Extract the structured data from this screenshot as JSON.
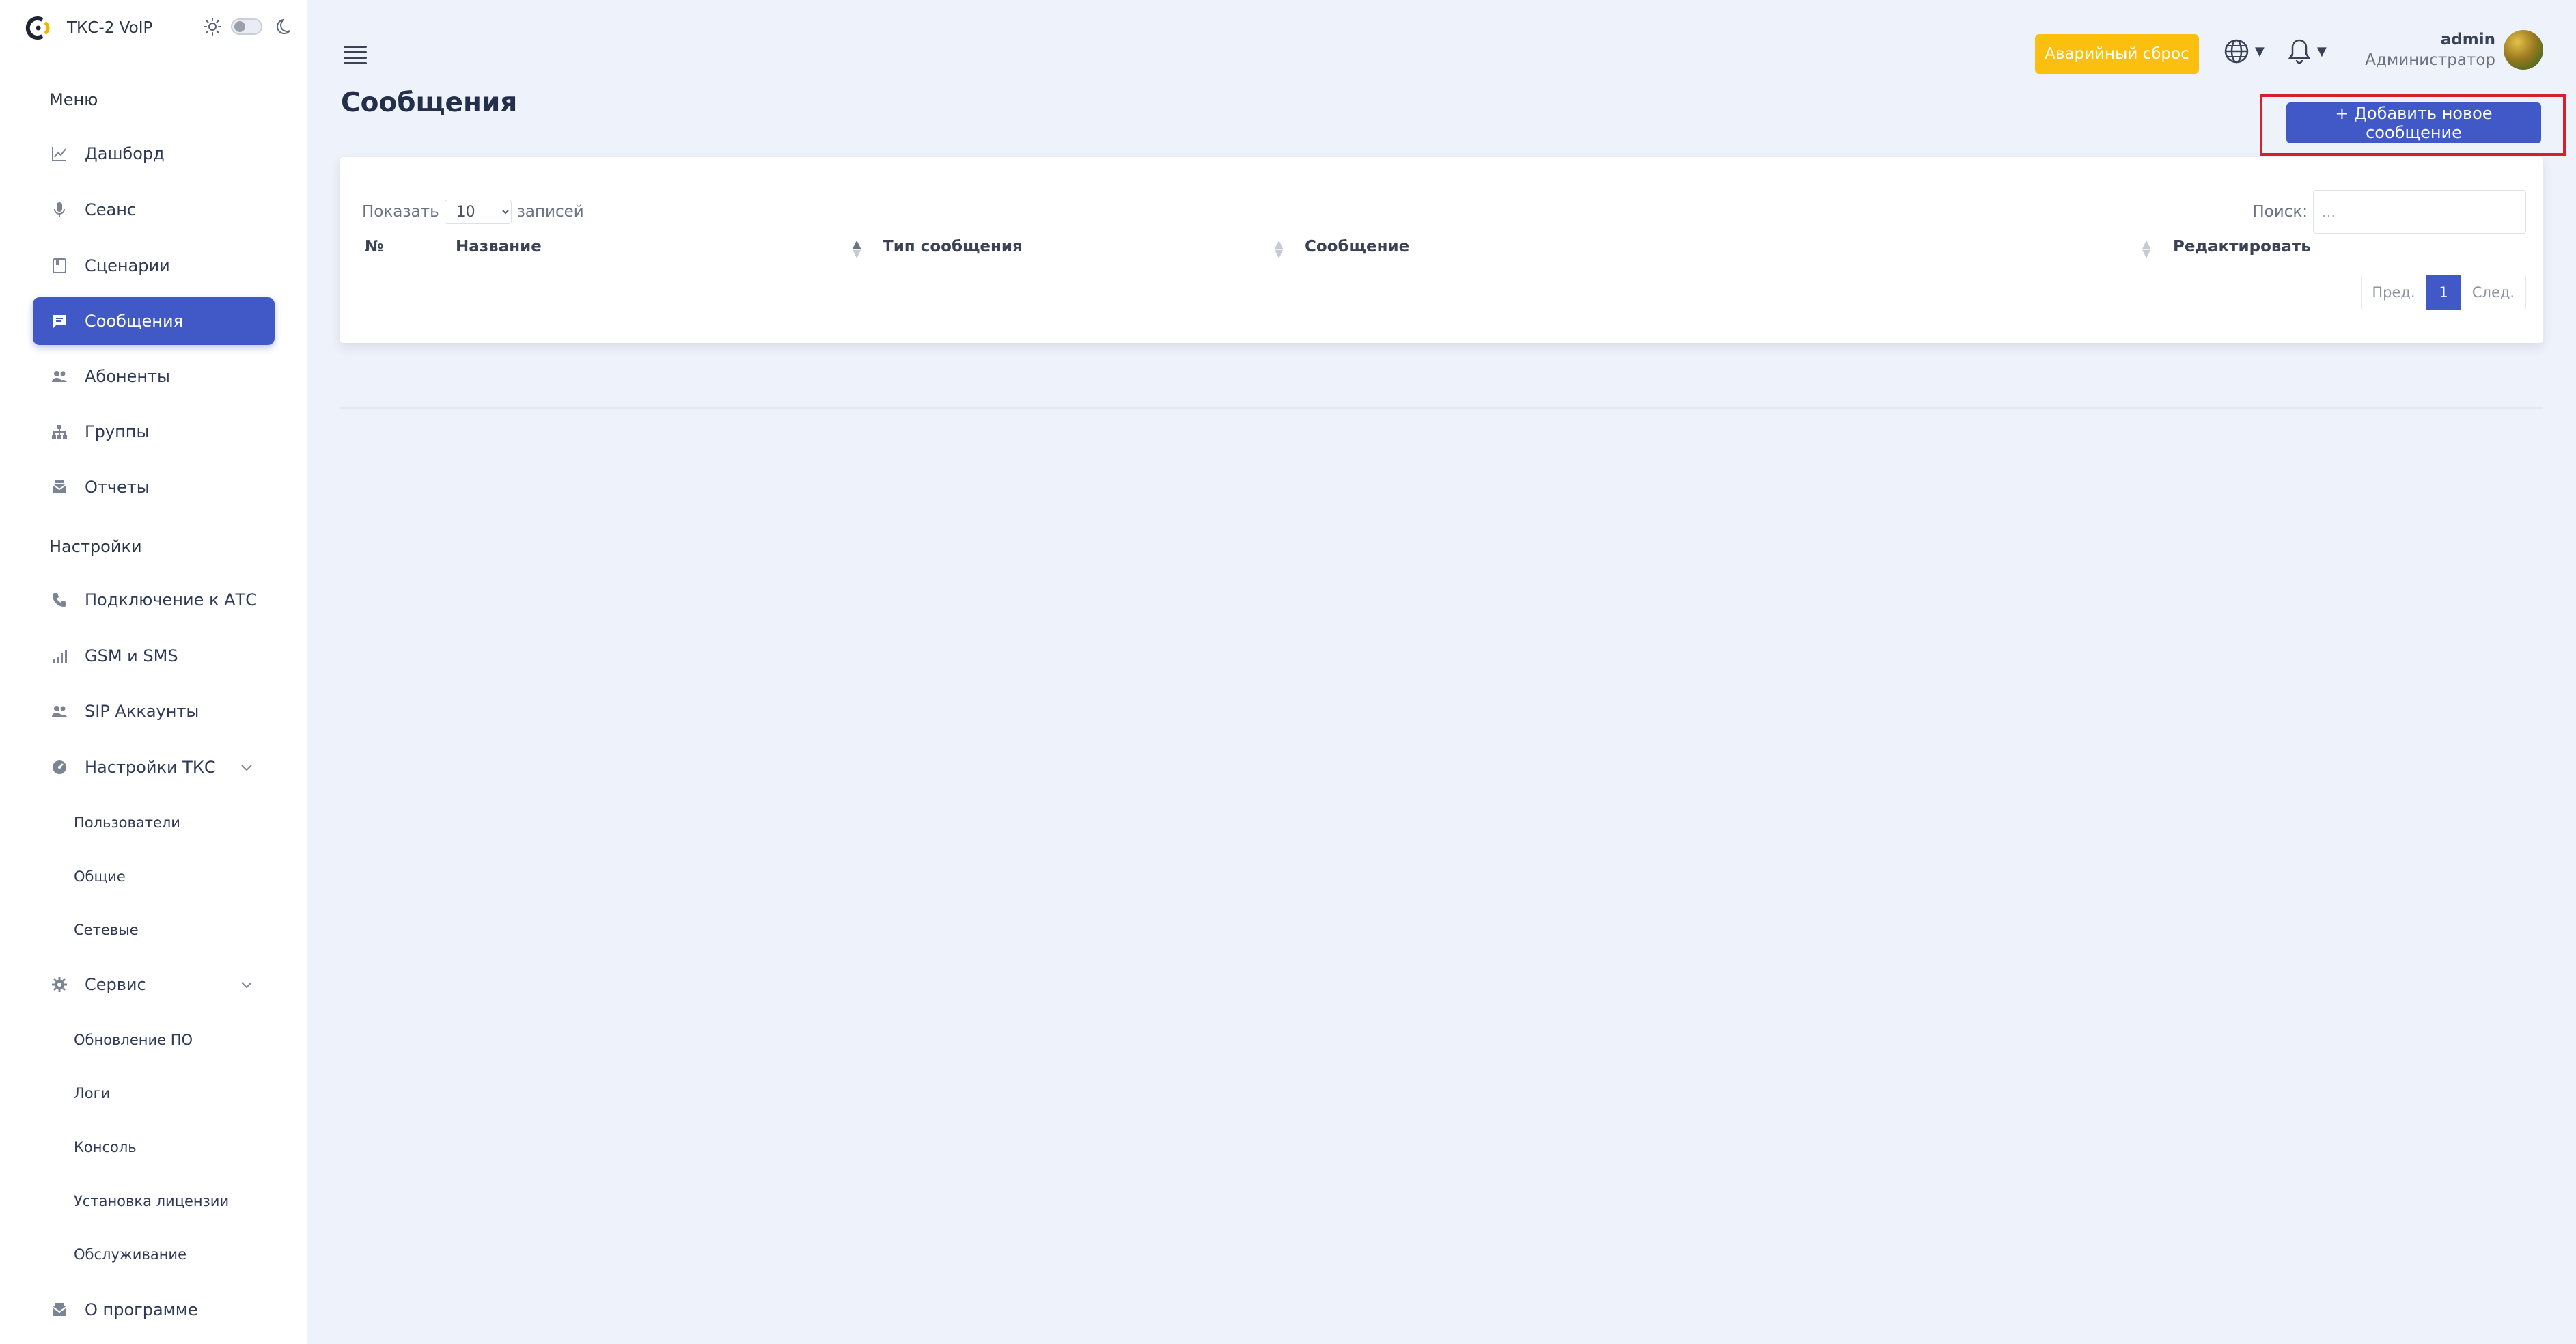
{
  "brand": {
    "name": "ТКС-2 VoIP"
  },
  "sidebar": {
    "menu_title": "Меню",
    "menu_items": [
      {
        "label": "Дашборд",
        "icon": "chart-line-icon"
      },
      {
        "label": "Сеанс",
        "icon": "microphone-icon"
      },
      {
        "label": "Сценарии",
        "icon": "book-icon"
      },
      {
        "label": "Сообщения",
        "icon": "message-icon",
        "active": true
      },
      {
        "label": "Абоненты",
        "icon": "users-icon"
      },
      {
        "label": "Группы",
        "icon": "hierarchy-icon"
      },
      {
        "label": "Отчеты",
        "icon": "mail-stack-icon"
      }
    ],
    "settings_title": "Настройки",
    "settings_items": [
      {
        "label": "Подключение к АТС",
        "icon": "phone-icon"
      },
      {
        "label": "GSM и SMS",
        "icon": "signal-bars-icon"
      },
      {
        "label": "SIP Аккаунты",
        "icon": "users-icon"
      },
      {
        "label": "Настройки ТКС",
        "icon": "dashboard-gauge-icon"
      }
    ],
    "tks_sub": [
      "Пользователи",
      "Общие",
      "Сетевые"
    ],
    "service": {
      "label": "Сервис",
      "icon": "gear-icon"
    },
    "service_sub": [
      "Обновление ПО",
      "Логи",
      "Консоль",
      "Установка лицензии",
      "Обслуживание"
    ],
    "about": {
      "label": "О программе",
      "icon": "mail-stack-icon"
    }
  },
  "header": {
    "panic_label": "Аварийный сброс",
    "user_name": "admin",
    "user_role": "Администратор"
  },
  "page": {
    "title": "Сообщения",
    "add_button": "+ Добавить новое сообщение"
  },
  "table": {
    "show_label": "Показать",
    "page_size": "10",
    "page_size_options": [
      "10"
    ],
    "records_label": "записей",
    "search_label": "Поиск:",
    "search_placeholder": "...",
    "columns": [
      "№",
      "Название",
      "Тип сообщения",
      "Сообщение",
      "Редактировать"
    ],
    "pager": {
      "prev": "Пред.",
      "current": "1",
      "next": "След."
    }
  },
  "colors": {
    "accent": "#4159c6",
    "panic": "#fbbf0f",
    "highlight": "#d8202a",
    "background": "#eef2fb"
  }
}
